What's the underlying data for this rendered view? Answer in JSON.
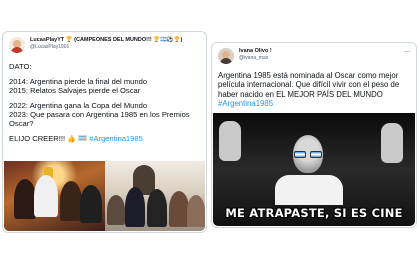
{
  "tweets": [
    {
      "display_name": "LucasPlayYT 🏆 (CAMPEONES DEL MUNDO!!! 🏆🇦🇷⚽🏆)",
      "handle": "@LucasPlay1901",
      "lines": {
        "l1": "DATO:",
        "l2": "2014: Argentina pierde la final del mundo",
        "l3": "2015: Relatos Salvajes pierde el Oscar",
        "l4": "2022: Argentina gana la Copa del Mundo",
        "l5": "2023: Que pasara con Argentina 1985 en los Premios Oscar?",
        "l6_prefix": "ELIJO CREER!!! ",
        "hashtag": "#Argentina1985"
      },
      "colors": {
        "avatar": "#c0392b"
      }
    },
    {
      "display_name": "Ivana Olivo !",
      "handle": "@ivana_max",
      "text": "Argentina 1985 está nominada al Oscar como mejor película internacional. Que difícil vivir con el peso de haber nacido en EL MEJOR PAÍS DEL MUNDO",
      "hashtag": "#Argentina1985",
      "meme_caption": "ME ATRAPASTE, SI ES CINE",
      "colors": {
        "avatar": "#4b3b36"
      }
    }
  ],
  "icons": {
    "menu": "more-horizontal-icon",
    "flag": "argentina-flag-icon",
    "thumb": "thumbs-up-icon"
  },
  "colors": {
    "hashtag": "#1d9bf0",
    "border": "#cfd9de",
    "text": "#0f1419",
    "muted": "#536471"
  }
}
